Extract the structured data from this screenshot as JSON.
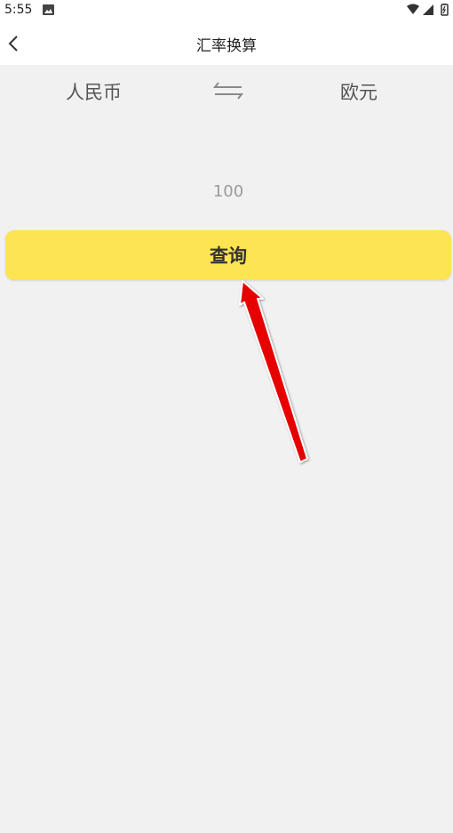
{
  "status_bar": {
    "time": "5:55",
    "icons": [
      "gallery-icon",
      "wifi-icon",
      "signal-icon",
      "battery-icon"
    ]
  },
  "header": {
    "title": "汇率换算",
    "back_icon": "chevron-left-icon"
  },
  "converter": {
    "from_currency": "人民币",
    "to_currency": "欧元",
    "swap_icon": "swap-arrows-icon",
    "amount_placeholder": "100"
  },
  "actions": {
    "query_label": "查询",
    "query_color": "#fce452"
  },
  "annotation": {
    "arrow_color": "#e60000",
    "arrow_target": "query-button"
  },
  "colors": {
    "background": "#f1f1f1",
    "header_bg": "#ffffff"
  }
}
